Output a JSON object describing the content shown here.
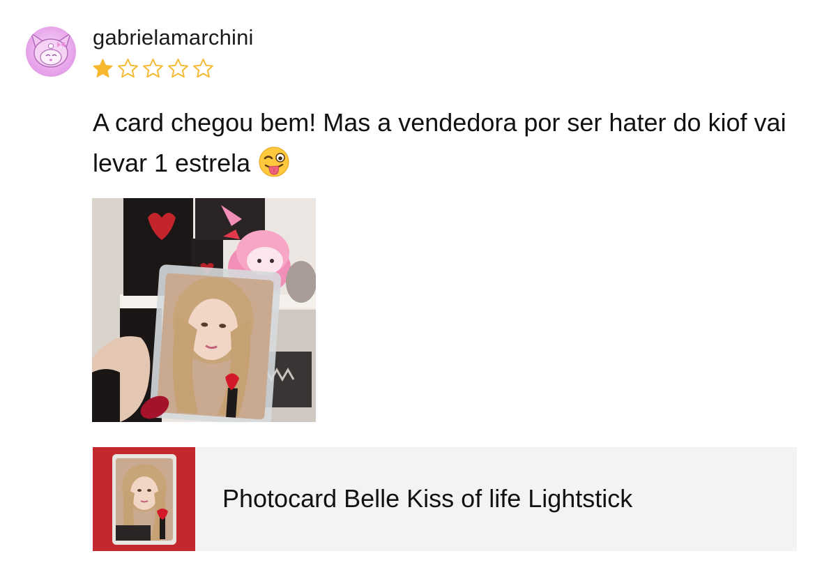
{
  "review": {
    "username": "gabrielamarchini",
    "avatar_icon": "kuromi-avatar-icon",
    "rating": 1,
    "max_rating": 5,
    "star_color": "#F5B82E",
    "text": "A card chegou bem! Mas a vendedora por ser hater do kiof vai levar 1 estrela",
    "emoji_icon": "winking-face-with-tongue-icon"
  },
  "product": {
    "title": "Photocard Belle Kiss of life Lightstick",
    "thumbnail_icon": "photocard-thumbnail"
  },
  "colors": {
    "product_background": "#F3F3F3",
    "thumbnail_background": "#C2282C"
  }
}
